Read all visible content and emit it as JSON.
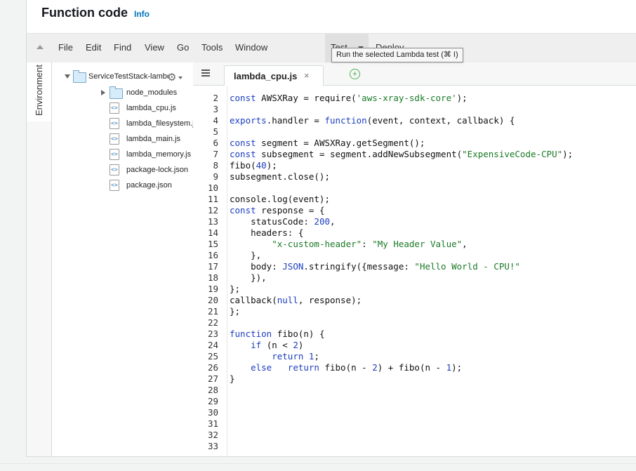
{
  "header": {
    "title": "Function code",
    "info": "Info"
  },
  "menubar": {
    "items": [
      "File",
      "Edit",
      "Find",
      "View",
      "Go",
      "Tools",
      "Window"
    ],
    "test_label": "Test",
    "deploy_label": "Deploy",
    "tooltip": "Run the selected Lambda test (⌘ I)"
  },
  "sidebar": {
    "environment_label": "Environment"
  },
  "tree": {
    "root_label": "ServiceTestStack-lambdaPerfomance...",
    "folder": "node_modules",
    "files": [
      "lambda_cpu.js",
      "lambda_filesystem.js",
      "lambda_main.js",
      "lambda_memory.js",
      "package-lock.json",
      "package.json"
    ]
  },
  "editor": {
    "active_tab": "lambda_cpu.js",
    "close_glyph": "×",
    "add_glyph": "+",
    "lines": [
      {
        "n": "2",
        "c": "const AWSXRay = require('aws-xray-sdk-core');"
      },
      {
        "n": "3",
        "c": ""
      },
      {
        "n": "4",
        "c": "exports.handler = function(event, context, callback) {"
      },
      {
        "n": "5",
        "c": ""
      },
      {
        "n": "6",
        "c": "const segment = AWSXRay.getSegment();"
      },
      {
        "n": "7",
        "c": "const subsegment = segment.addNewSubsegment(\"ExpensiveCode-CPU\");"
      },
      {
        "n": "8",
        "c": "fibo(40);"
      },
      {
        "n": "9",
        "c": "subsegment.close();"
      },
      {
        "n": "10",
        "c": ""
      },
      {
        "n": "11",
        "c": "console.log(event);"
      },
      {
        "n": "12",
        "c": "const response = {"
      },
      {
        "n": "13",
        "c": "    statusCode: 200,"
      },
      {
        "n": "14",
        "c": "    headers: {"
      },
      {
        "n": "15",
        "c": "        \"x-custom-header\": \"My Header Value\","
      },
      {
        "n": "16",
        "c": "    },"
      },
      {
        "n": "17",
        "c": "    body: JSON.stringify({message: \"Hello World - CPU!\""
      },
      {
        "n": "18",
        "c": "    }),"
      },
      {
        "n": "19",
        "c": "};"
      },
      {
        "n": "20",
        "c": "callback(null, response);"
      },
      {
        "n": "21",
        "c": "};"
      },
      {
        "n": "22",
        "c": ""
      },
      {
        "n": "23",
        "c": "function fibo(n) {"
      },
      {
        "n": "24",
        "c": "    if (n < 2)"
      },
      {
        "n": "25",
        "c": "        return 1;"
      },
      {
        "n": "26",
        "c": "    else   return fibo(n - 2) + fibo(n - 1);"
      },
      {
        "n": "27",
        "c": "}"
      },
      {
        "n": "28",
        "c": ""
      },
      {
        "n": "29",
        "c": ""
      },
      {
        "n": "30",
        "c": ""
      },
      {
        "n": "31",
        "c": ""
      },
      {
        "n": "32",
        "c": ""
      },
      {
        "n": "33",
        "c": ""
      }
    ]
  },
  "colors": {
    "info_link": "#0073bb",
    "keyword": "#1d3dbf",
    "string": "#1a7a26",
    "add_icon": "#4fae4f"
  }
}
